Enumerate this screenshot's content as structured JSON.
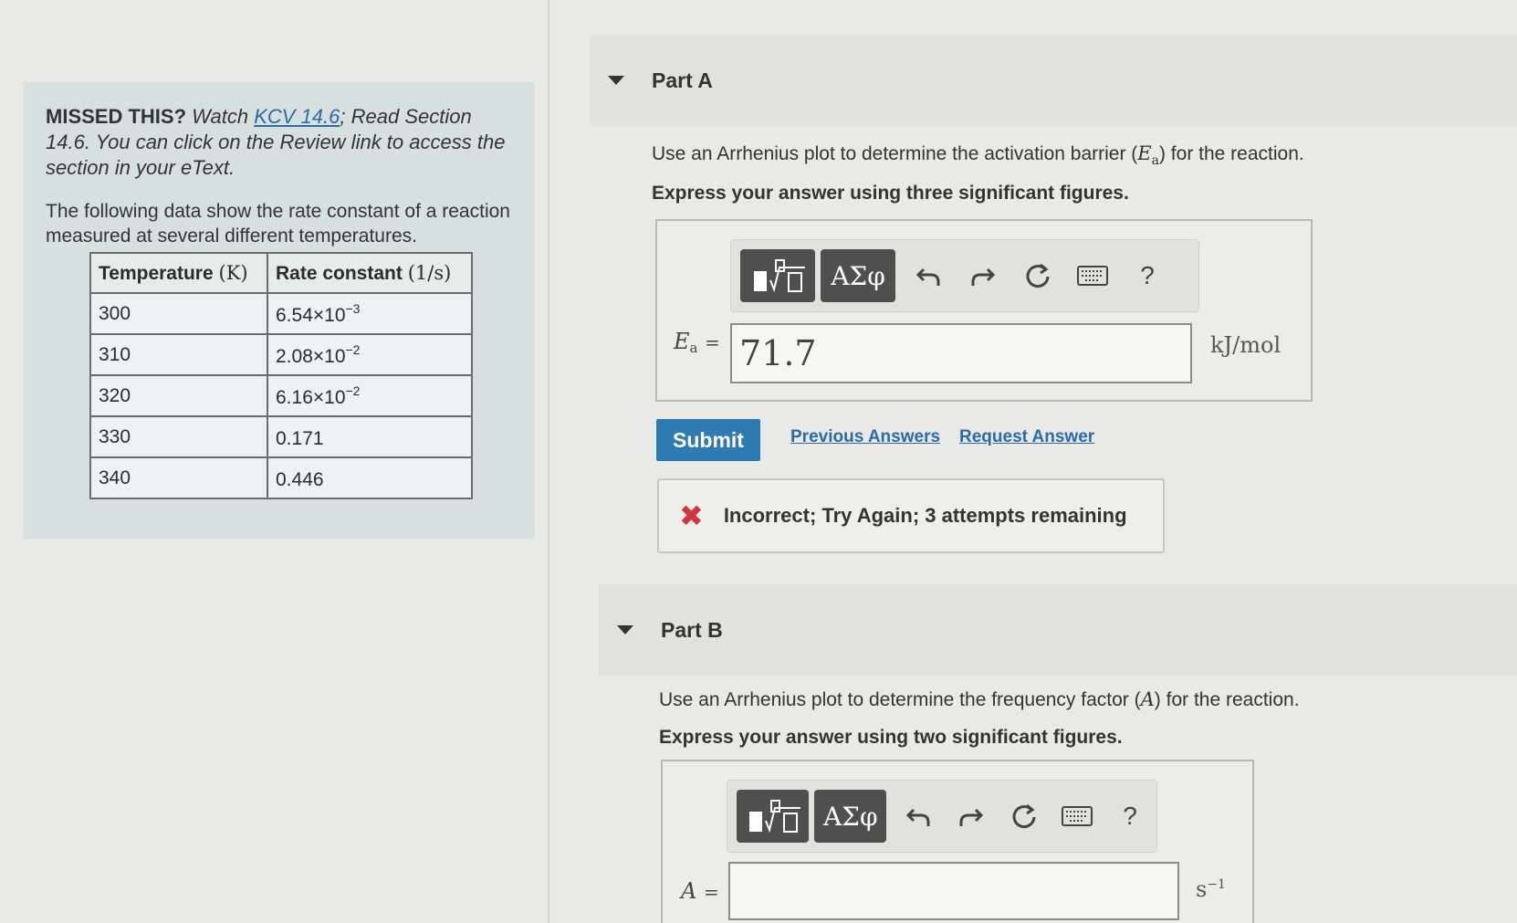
{
  "left": {
    "missed_label": "MISSED THIS?",
    "missed_watch": "Watch",
    "missed_link": "KCV 14.6",
    "missed_rest": "; Read Section 14.6. You can click on the Review link to access the section in your eText.",
    "intro": "The following data show the rate constant of a reaction measured at several different temperatures.",
    "table": {
      "headers": [
        "Temperature",
        "(K)",
        "Rate constant",
        "(1/s)"
      ],
      "rows": [
        {
          "t": "300",
          "k_base": "6.54×10",
          "k_exp": "−3"
        },
        {
          "t": "310",
          "k_base": "2.08×10",
          "k_exp": "−2"
        },
        {
          "t": "320",
          "k_base": "6.16×10",
          "k_exp": "−2"
        },
        {
          "t": "330",
          "k_base": "0.171",
          "k_exp": ""
        },
        {
          "t": "340",
          "k_base": "0.446",
          "k_exp": ""
        }
      ]
    }
  },
  "partA": {
    "title": "Part A",
    "question_pre": "Use an Arrhenius plot to determine the activation barrier (",
    "question_var": "E",
    "question_sub": "a",
    "question_post": ") for the reaction.",
    "instruction": "Express your answer using three significant figures.",
    "greek_label": "ΑΣφ",
    "help_label": "?",
    "answer_var": "E",
    "answer_sub": "a",
    "answer_eq": "=",
    "answer_value": "71.7",
    "unit": "kJ/mol",
    "submit": "Submit",
    "previous": "Previous Answers",
    "request": "Request Answer",
    "feedback_icon": "✖",
    "feedback": "Incorrect; Try Again; 3 attempts remaining"
  },
  "partB": {
    "title": "Part B",
    "question_pre": "Use an Arrhenius plot to determine the frequency factor (",
    "question_var": "A",
    "question_post": ") for the reaction.",
    "instruction": "Express your answer using two significant figures.",
    "greek_label": "ΑΣφ",
    "help_label": "?",
    "answer_var": "A",
    "answer_eq": "=",
    "answer_value": "",
    "unit_base": "s",
    "unit_exp": "−1"
  },
  "icons": [
    "template-icon",
    "undo-icon",
    "redo-icon",
    "reset-icon",
    "keyboard-icon",
    "help-icon",
    "collapse-triangle-icon",
    "incorrect-x-icon"
  ]
}
